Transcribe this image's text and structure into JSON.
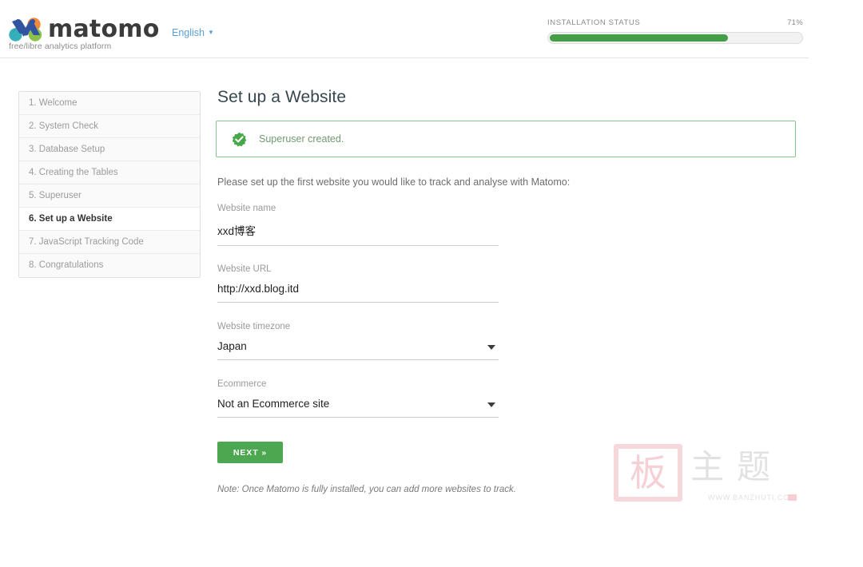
{
  "header": {
    "logo_text": "matomo",
    "tagline": "free/libre analytics platform",
    "language": "English",
    "language_caret": "▼",
    "installation_status_label": "INSTALLATION STATUS",
    "installation_percent_label": "71%",
    "installation_percent": 71,
    "progress_color": "#449e48"
  },
  "sidebar": {
    "items": [
      {
        "label": "1. Welcome",
        "active": false
      },
      {
        "label": "2. System Check",
        "active": false
      },
      {
        "label": "3. Database Setup",
        "active": false
      },
      {
        "label": "4. Creating the Tables",
        "active": false
      },
      {
        "label": "5. Superuser",
        "active": false
      },
      {
        "label": "6. Set up a Website",
        "active": true
      },
      {
        "label": "7. JavaScript Tracking Code",
        "active": false
      },
      {
        "label": "8. Congratulations",
        "active": false
      }
    ]
  },
  "main": {
    "title": "Set up a Website",
    "alert": {
      "icon": "success-check-badge-icon",
      "message": "Superuser created.",
      "border_color": "#8cc48f",
      "text_color": "#6f9b72"
    },
    "intro": "Please set up the first website you would like to track and analyse with Matomo:",
    "fields": [
      {
        "label": "Website name",
        "value": "xxd博客",
        "placeholder": "",
        "type": "text",
        "name": "website-name"
      },
      {
        "label": "Website URL",
        "value": "http://xxd.blog.itd",
        "placeholder": "",
        "type": "text",
        "name": "website-url"
      },
      {
        "label": "Website timezone",
        "value": "Japan",
        "placeholder": "",
        "type": "select",
        "name": "website-timezone"
      },
      {
        "label": "Ecommerce",
        "value": "Not an Ecommerce site",
        "placeholder": "",
        "type": "select",
        "name": "ecommerce"
      }
    ],
    "next_button": "NEXT »",
    "next_button_color": "#4ca750",
    "note": "Note: Once Matomo is fully installed, you can add more websites to track."
  },
  "watermark": {
    "seal_char": "板",
    "chars": "主题",
    "url": "WWW.BANZHUTI.COM"
  }
}
